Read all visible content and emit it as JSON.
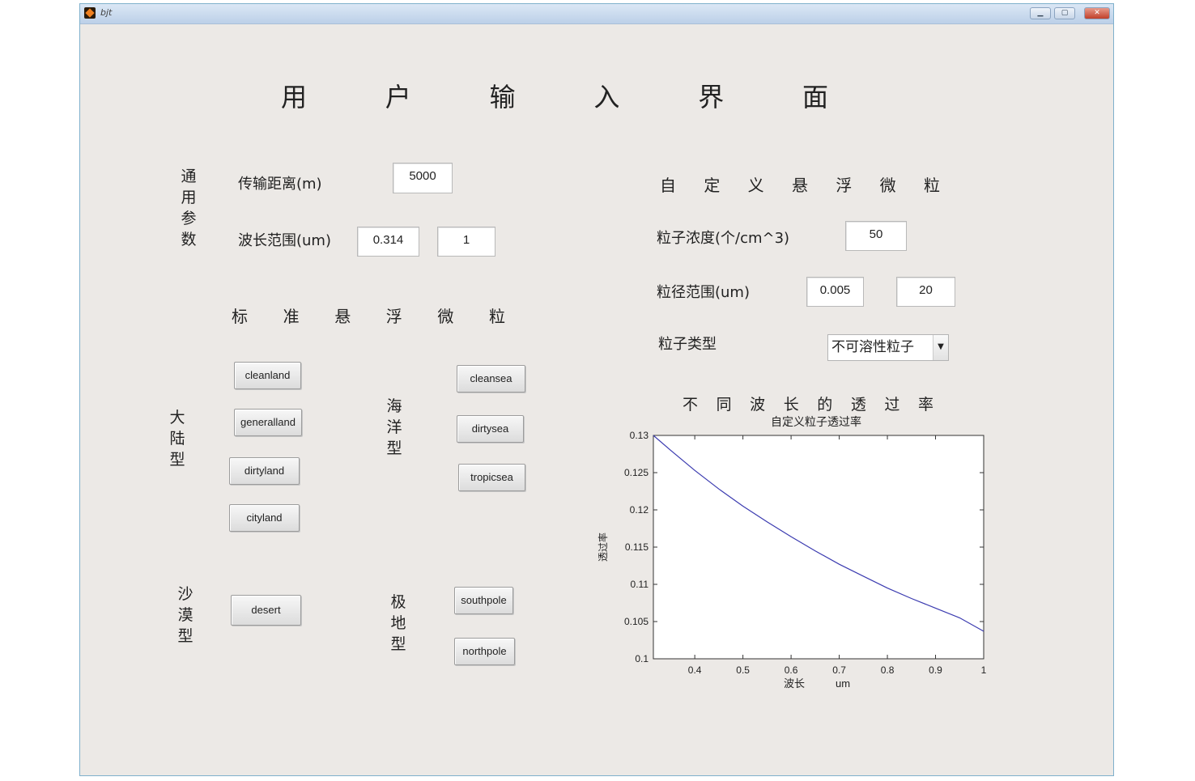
{
  "window": {
    "title": "bjt"
  },
  "main_title": [
    "用",
    "户",
    "输",
    "入",
    "界",
    "面"
  ],
  "general": {
    "group_label": [
      "通",
      "用",
      "参",
      "数"
    ],
    "distance_label": "传输距离(m)",
    "distance_value": "5000",
    "wavelength_label": "波长范围(um)",
    "wavelength_min": "0.314",
    "wavelength_max": "1"
  },
  "standard": {
    "title": [
      "标",
      "准",
      "悬",
      "浮",
      "微",
      "粒"
    ],
    "continental_label": [
      "大",
      "陆",
      "型"
    ],
    "ocean_label": [
      "海",
      "洋",
      "型"
    ],
    "desert_label": [
      "沙",
      "漠",
      "型"
    ],
    "polar_label": [
      "极",
      "地",
      "型"
    ],
    "buttons": {
      "cleanland": "cleanland",
      "generalland": "generalland",
      "dirtyland": "dirtyland",
      "cityland": "cityland",
      "cleansea": "cleansea",
      "dirtysea": "dirtysea",
      "tropicsea": "tropicsea",
      "desert": "desert",
      "southpole": "southpole",
      "northpole": "northpole"
    }
  },
  "custom": {
    "title": [
      "自",
      "定",
      "义",
      "悬",
      "浮",
      "微",
      "粒"
    ],
    "concentration_label": "粒子浓度(个/cm^3)",
    "concentration_value": "50",
    "radius_label": "粒径范围(um)",
    "radius_min": "0.005",
    "radius_max": "20",
    "type_label": "粒子类型",
    "type_selected": "不可溶性粒子"
  },
  "plot_heading": [
    "不",
    "同",
    "波",
    "长",
    "的",
    "透",
    "过",
    "率"
  ],
  "chart_data": {
    "type": "line",
    "title": "自定义粒子透过率",
    "xlabel": [
      "波长",
      "um"
    ],
    "ylabel": "透过率",
    "xlim": [
      0.314,
      1
    ],
    "ylim": [
      0.1,
      0.13
    ],
    "xticks": [
      "0.4",
      "0.5",
      "0.6",
      "0.7",
      "0.8",
      "0.9",
      "1"
    ],
    "yticks": [
      "0.1",
      "0.105",
      "0.11",
      "0.115",
      "0.12",
      "0.125",
      "0.13"
    ],
    "line_color": "#3b3bb0",
    "x": [
      0.314,
      0.35,
      0.4,
      0.45,
      0.5,
      0.55,
      0.6,
      0.65,
      0.7,
      0.75,
      0.8,
      0.85,
      0.9,
      0.95,
      1.0
    ],
    "y": [
      0.13,
      0.128,
      0.1253,
      0.1228,
      0.1205,
      0.1184,
      0.1164,
      0.1145,
      0.1127,
      0.1111,
      0.1095,
      0.1081,
      0.1068,
      0.1055,
      0.1037
    ]
  }
}
